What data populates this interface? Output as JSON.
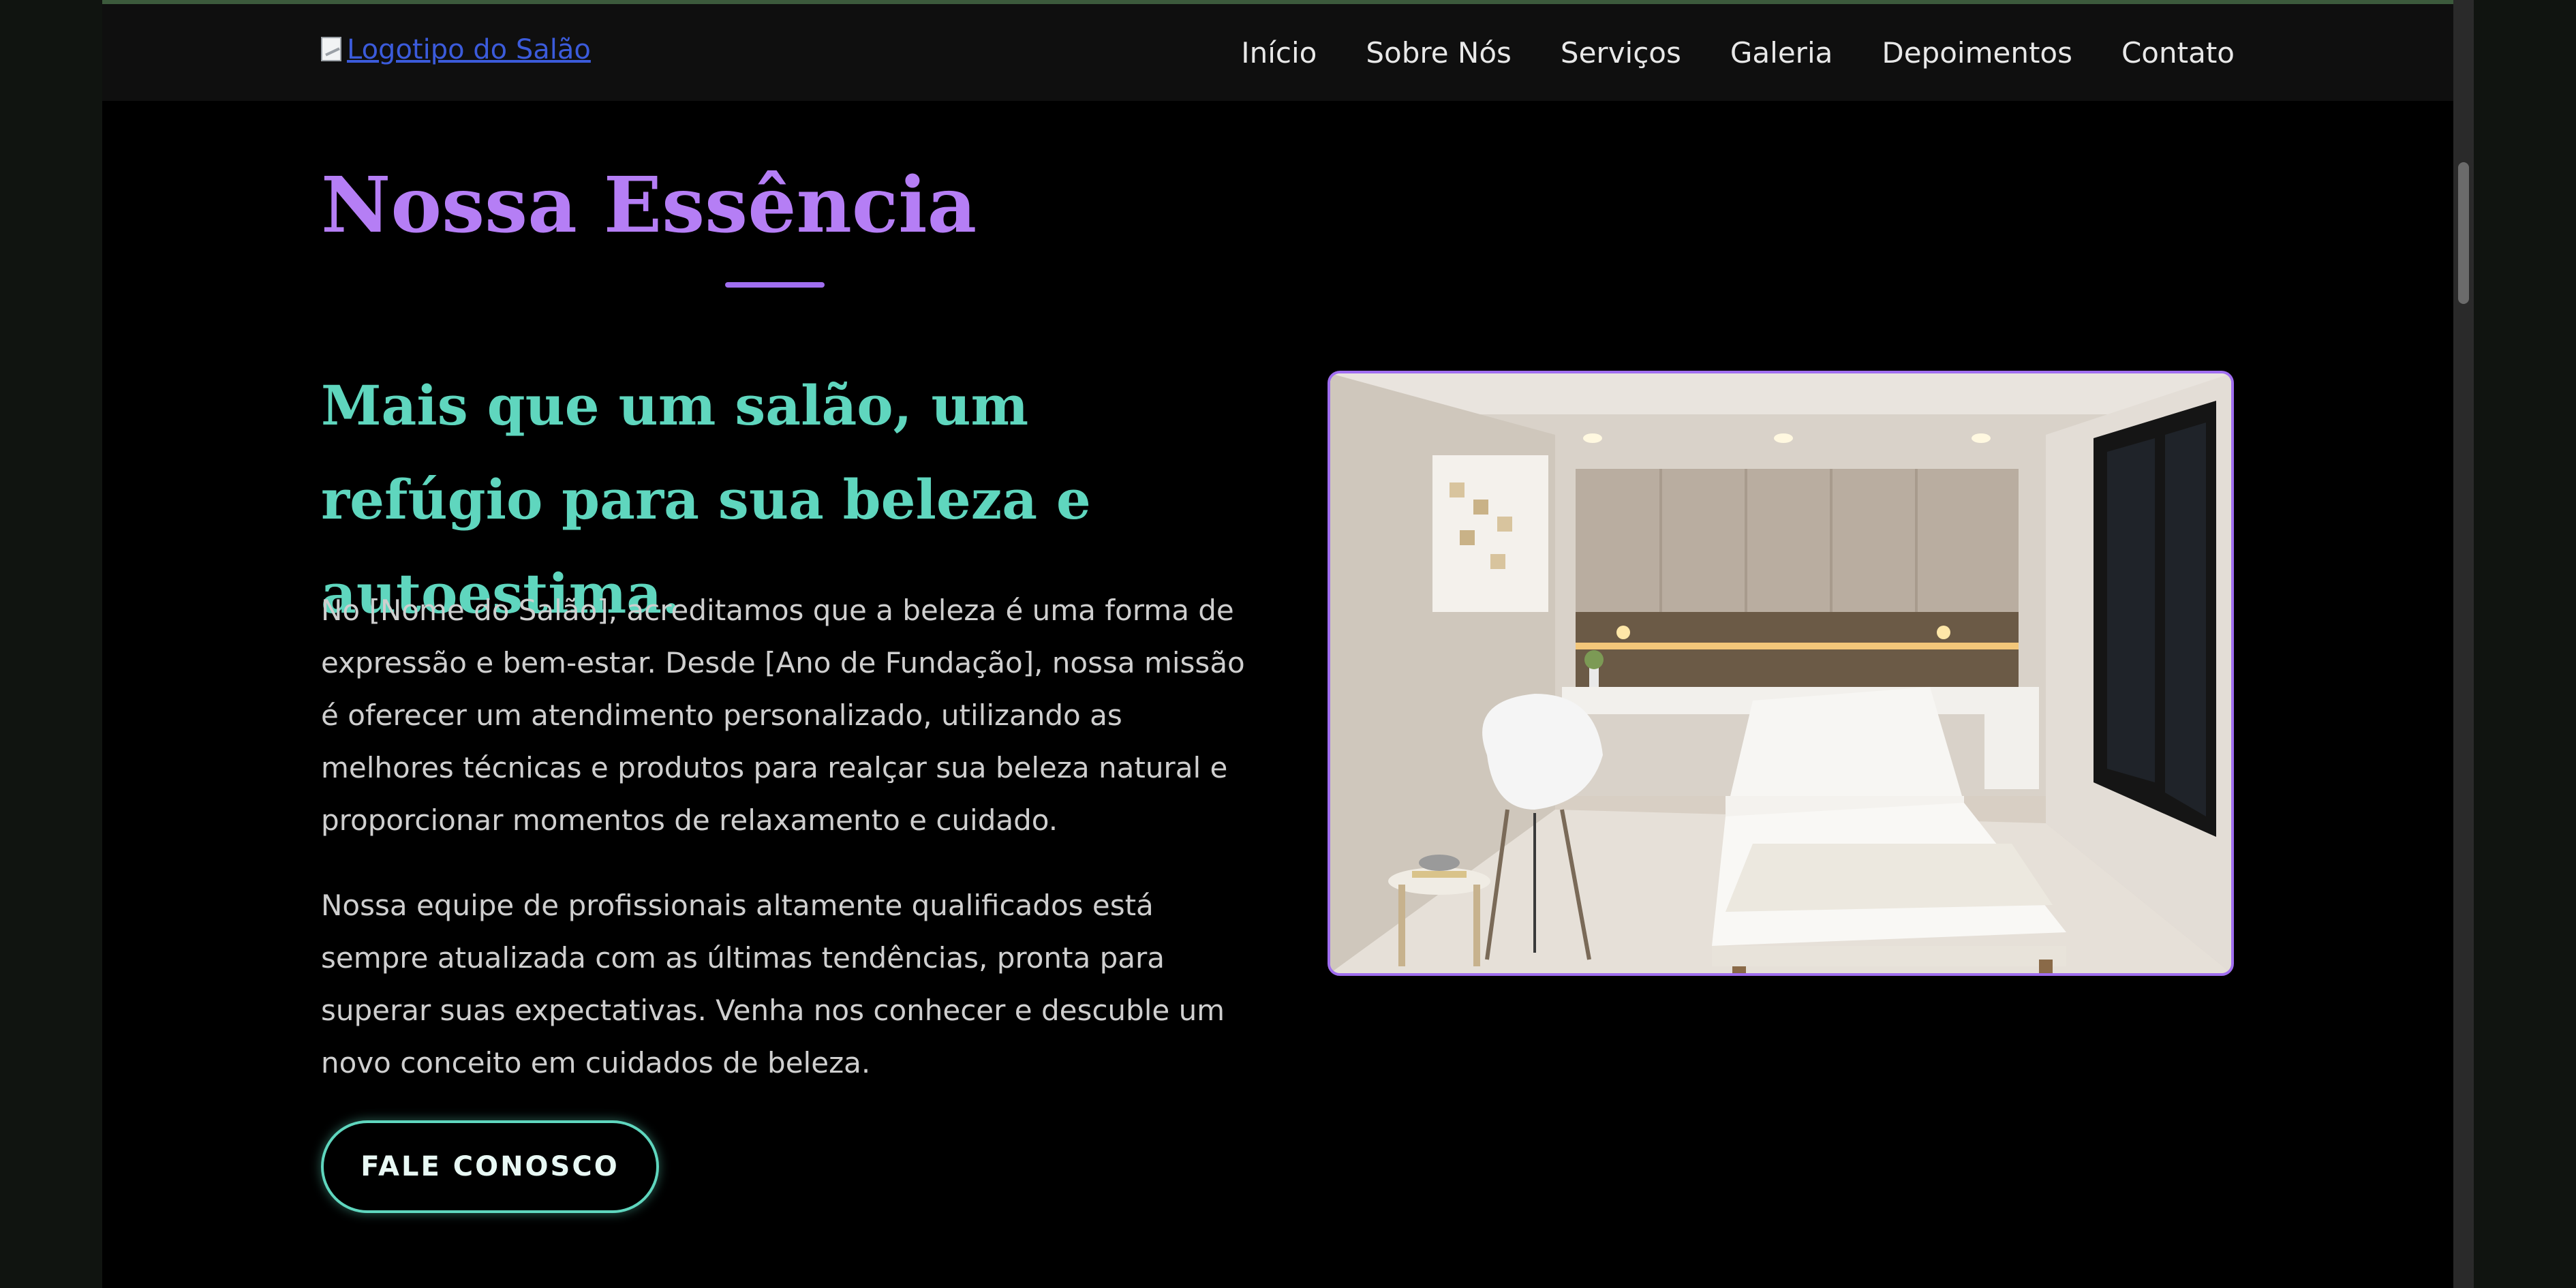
{
  "navbar": {
    "logo_alt": "Logotipo do Salão",
    "links": [
      {
        "label": "Início"
      },
      {
        "label": "Sobre Nós"
      },
      {
        "label": "Serviços"
      },
      {
        "label": "Galeria"
      },
      {
        "label": "Depoimentos"
      },
      {
        "label": "Contato"
      }
    ]
  },
  "about": {
    "title": "Nossa Essência",
    "subheading": "Mais que um salão, um refúgio para sua beleza e autoestima.",
    "paragraphs": [
      "No [Nome do Salão], acreditamos que a beleza é uma forma de expressão e bem-estar. Desde [Ano de Fundação], nossa missão é oferecer um atendimento personalizado, utilizando as melhores técnicas e produtos para realçar sua beleza natural e proporcionar momentos de relaxamento e cuidado.",
      "Nossa equipe de profissionais altamente qualificados está sempre atualizada com as últimas tendências, pronta para superar suas expectativas. Venha nos conhecer e descuble um novo conceito em cuidados de beleza."
    ],
    "cta_label": "FALE CONOSCO"
  },
  "colors": {
    "accent_purple": "#b57ef5",
    "accent_teal": "#5fd6be",
    "background": "#000000"
  }
}
